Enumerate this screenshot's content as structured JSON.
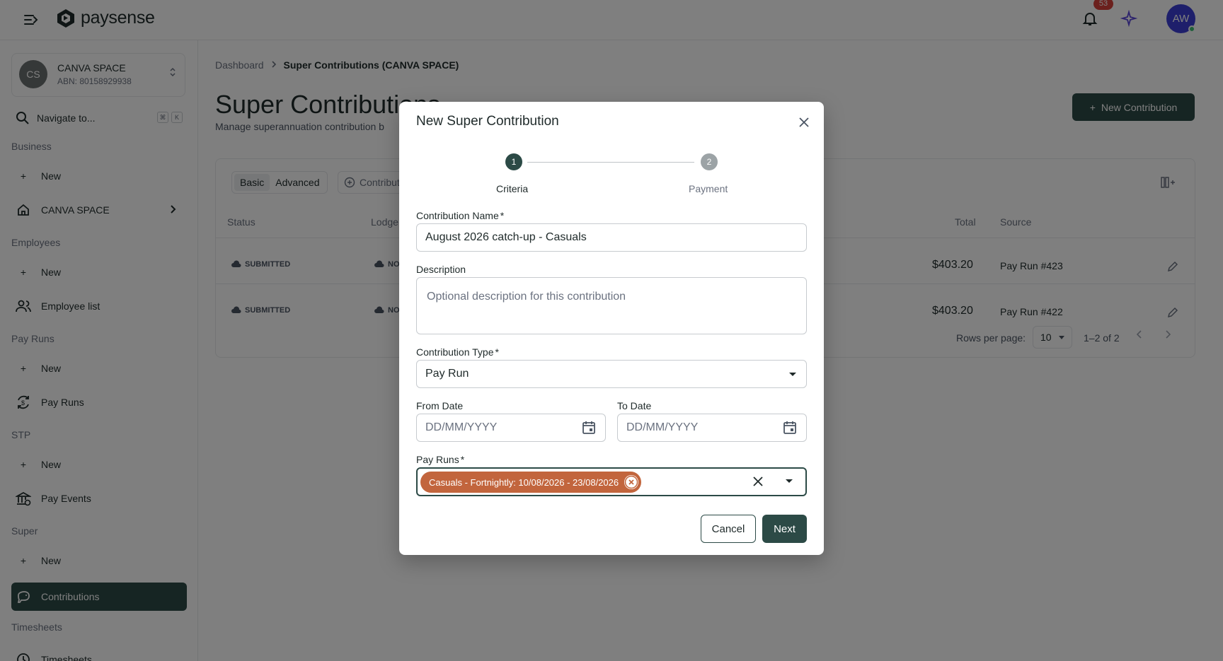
{
  "app": {
    "brand": "paysense",
    "notifications_count": "53",
    "user_initials": "AW"
  },
  "sidebar": {
    "org": {
      "initials": "CS",
      "name": "CANVA SPACE",
      "abn": "ABN: 80158929938"
    },
    "navigate_label": "Navigate to...",
    "shortcut_keys": [
      "⌘",
      "K"
    ],
    "sections": {
      "business": "Business",
      "employees": "Employees",
      "pay_runs": "Pay Runs",
      "stp": "STP",
      "super": "Super",
      "timesheets": "Timesheets"
    },
    "items": {
      "business_new": "New",
      "business_org": "CANVA SPACE",
      "employees_new": "New",
      "employee_list": "Employee list",
      "payruns_new": "New",
      "pay_runs": "Pay Runs",
      "stp_new": "New",
      "pay_events": "Pay Events",
      "super_new": "New",
      "contributions": "Contributions",
      "timesheets": "Timesheets"
    }
  },
  "main": {
    "breadcrumb": {
      "home": "Dashboard",
      "current": "Super Contributions (CANVA SPACE)"
    },
    "title": "Super Contributions",
    "subtitle": "Manage superannuation contribution b",
    "new_button": "New Contribution",
    "table": {
      "view_tabs": [
        "Basic",
        "Advanced"
      ],
      "filter_label": "Contributi",
      "columns": {
        "status": "Status",
        "lodgement": "Lodge",
        "total": "Total",
        "source": "Source"
      },
      "rows": [
        {
          "status": "SUBMITTED",
          "lodgement": "NO",
          "total": "$403.20",
          "source": "Pay Run #423"
        },
        {
          "status": "SUBMITTED",
          "lodgement": "NO",
          "total": "$403.20",
          "source": "Pay Run #422"
        }
      ],
      "pagination": {
        "rows_per_page_label": "Rows per page:",
        "rows_per_page": "10",
        "range": "1–2 of 2"
      }
    }
  },
  "modal": {
    "title": "New Super Contribution",
    "steps": [
      {
        "number": "1",
        "label": "Criteria"
      },
      {
        "number": "2",
        "label": "Payment"
      }
    ],
    "fields": {
      "name_label": "Contribution Name",
      "name_value": "August 2026 catch-up - Casuals",
      "description_label": "Description",
      "description_placeholder": "Optional description for this contribution",
      "type_label": "Contribution Type",
      "type_value": "Pay Run",
      "from_label": "From Date",
      "from_placeholder": "DD/MM/YYYY",
      "to_label": "To Date",
      "to_placeholder": "DD/MM/YYYY",
      "payruns_label": "Pay Runs",
      "payruns_selected": [
        "Casuals - Fortnightly: 10/08/2026 - 23/08/2026"
      ],
      "required_mark": "*"
    },
    "buttons": {
      "cancel": "Cancel",
      "next": "Next"
    }
  }
}
